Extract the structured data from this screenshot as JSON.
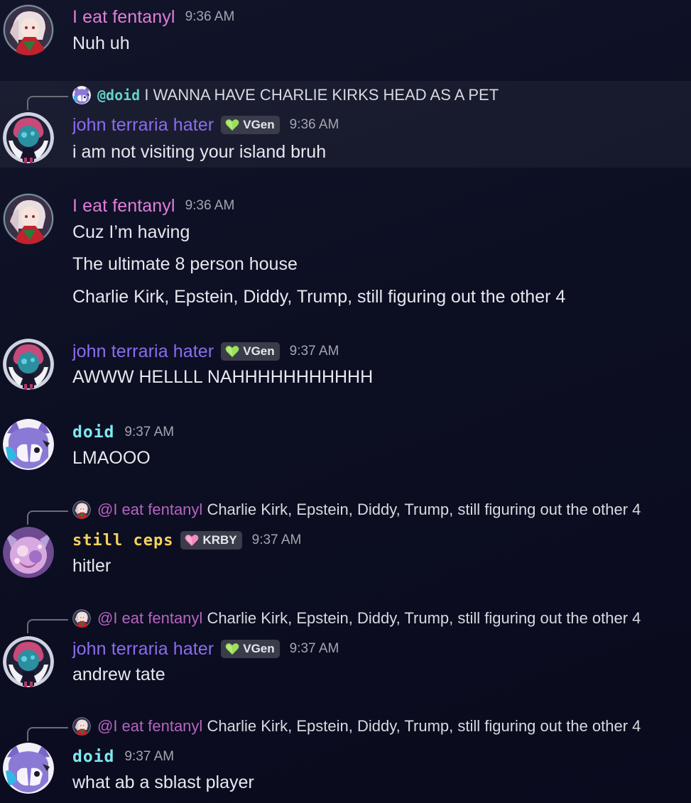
{
  "colors": {
    "background": "#0e1025",
    "fent_name": "#e07fd9",
    "john_name": "#8b6cf0",
    "doid_name": "#7fe8ef",
    "ceps_name": "#f5d35a",
    "vgen_heart": "#9be05a",
    "krby_heart": "#f58ac0",
    "timestamp": "#a3a5b0"
  },
  "messages": [
    {
      "author": "I eat fentanyl",
      "time": "9:36 AM",
      "avatar": "anime-girl-avatar",
      "lines": [
        "Nuh uh"
      ]
    },
    {
      "reply": {
        "mention": "@doid",
        "text": "I WANNA HAVE CHARLIE KIRKS HEAD AS A PET"
      },
      "author": "john terraria hater",
      "tag": "VGen",
      "tag_icon": "green-heart-icon",
      "time": "9:36 AM",
      "lines": [
        "i am not visiting your island bruh"
      ],
      "highlighted": true
    },
    {
      "author": "I eat fentanyl",
      "time": "9:36 AM",
      "lines": [
        "Cuz I’m having",
        "The ultimate 8 person house",
        "Charlie Kirk, Epstein, Diddy, Trump, still figuring out the other 4"
      ]
    },
    {
      "author": "john terraria hater",
      "tag": "VGen",
      "time": "9:37 AM",
      "lines": [
        "AWWW HELLLL NAHHHHHHHHHHH"
      ]
    },
    {
      "author": "doid",
      "time": "9:37 AM",
      "lines": [
        "LMAOOO"
      ]
    },
    {
      "reply": {
        "mention": "@I eat fentanyl",
        "text": "Charlie Kirk, Epstein, Diddy, Trump, still figuring out the other 4"
      },
      "author": "still ceps",
      "tag": "KRBY",
      "tag_icon": "pink-heart-icon",
      "time": "9:37 AM",
      "lines": [
        "hitler"
      ]
    },
    {
      "reply": {
        "mention": "@I eat fentanyl",
        "text": "Charlie Kirk, Epstein, Diddy, Trump, still figuring out the other 4"
      },
      "author": "john terraria hater",
      "tag": "VGen",
      "time": "9:37 AM",
      "lines": [
        "andrew tate"
      ]
    },
    {
      "reply": {
        "mention": "@I eat fentanyl",
        "text": "Charlie Kirk, Epstein, Diddy, Trump, still figuring out the other 4"
      },
      "author": "doid",
      "time": "9:37 AM",
      "lines": [
        "what ab a sblast player"
      ]
    }
  ]
}
